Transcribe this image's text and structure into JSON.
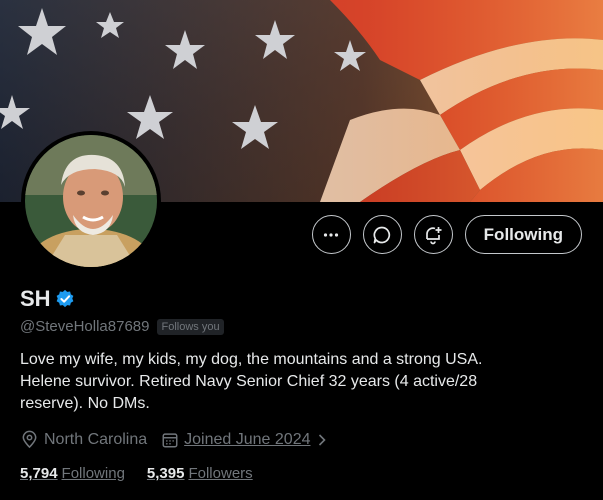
{
  "profile": {
    "name": "SH",
    "handle": "@SteveHolla87689",
    "follows_you": "Follows you",
    "bio_lines": [
      "Love my wife, my kids, my dog, the mountains and a strong USA.",
      "Helene survivor.  Retired Navy Senior Chief 32 years (4 active/28",
      "reserve).  No DMs."
    ],
    "location": "North Carolina",
    "joined": "Joined June 2024",
    "following_count": "5,794",
    "following_label": "Following",
    "followers_count": "5,395",
    "followers_label": "Followers"
  },
  "actions": {
    "following_button": "Following"
  },
  "icons": {
    "more": "more-icon",
    "message": "message-icon",
    "notify": "bell-plus-icon",
    "verified": "verified-badge-icon",
    "location": "location-pin-icon",
    "calendar": "calendar-icon",
    "chevron": "chevron-right-icon"
  },
  "colors": {
    "background": "#000000",
    "text_primary": "#e7e9ea",
    "text_secondary": "#71767b",
    "verified_blue": "#1d9bf0",
    "button_border": "#c4c8cc"
  }
}
